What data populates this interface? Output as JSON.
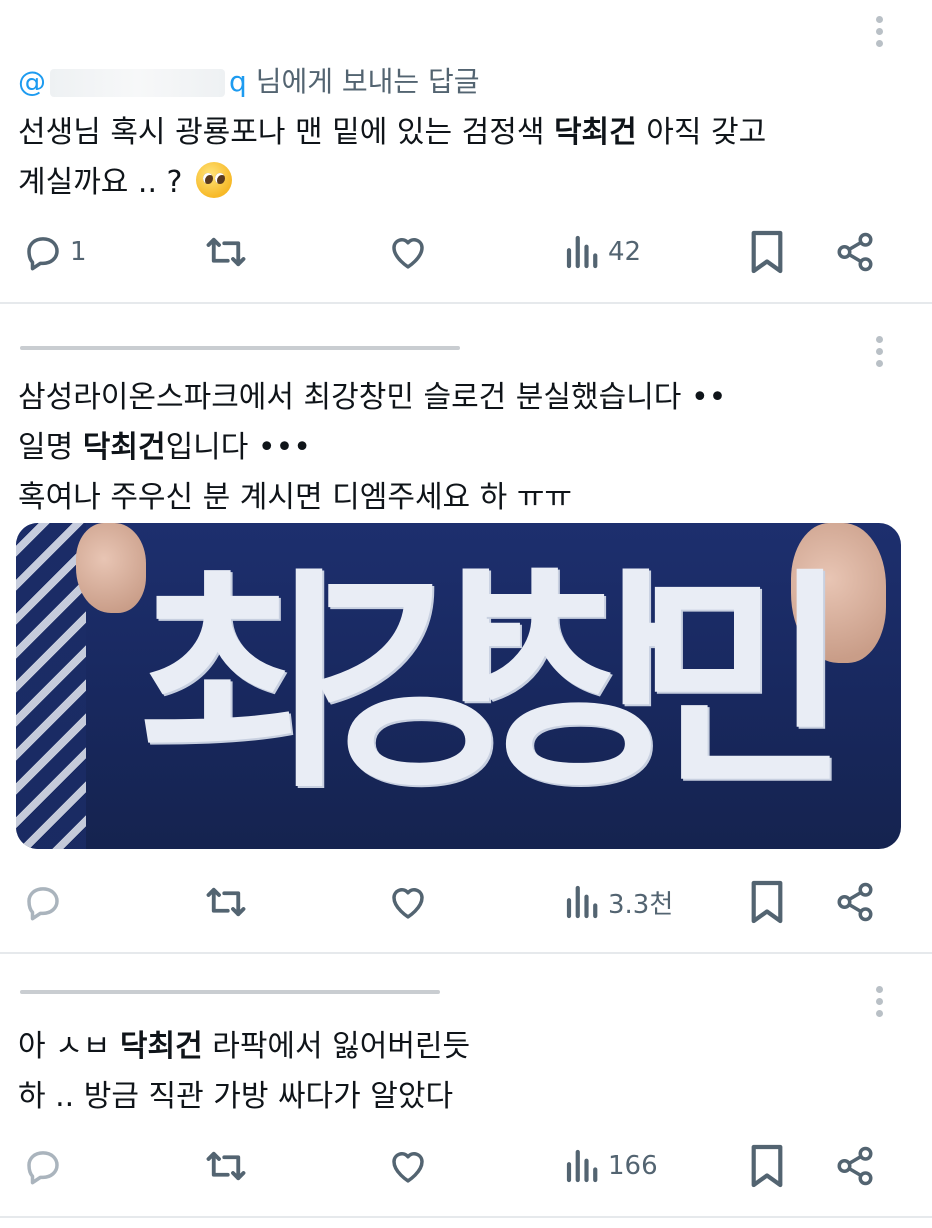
{
  "tweets": [
    {
      "reply_to_prefix": "@",
      "reply_to_suffix": "q",
      "reply_to_label": "님에게 보내는 답글",
      "lines": [
        [
          "선생님 혹시 광룡포나 맨 밑에 있는 검정색 ",
          "닥최건",
          " 아직 갖고"
        ],
        [
          "계실까요 .. ? ",
          "",
          ""
        ]
      ],
      "emoji": "pleading-face",
      "reply_count": "1",
      "view_count": "42"
    },
    {
      "lines": [
        [
          "삼성라이온스파크에서 최강창민 슬로건 분실했습니다 ••",
          "",
          ""
        ],
        [
          "일명 ",
          "닥최건",
          "입니다 •••"
        ],
        [
          "혹여나 주우신 분 계시면 디엠주세요 하 ㅠㅠ",
          "",
          ""
        ]
      ],
      "image_text": [
        "최",
        "강",
        "창",
        "민"
      ],
      "reply_count": "",
      "view_count": "3.3천"
    },
    {
      "lines": [
        [
          "아 ㅅㅂ ",
          "닥최건",
          " 라팍에서 잃어버린듯"
        ],
        [
          "하 .. 방금 직관 가방 싸다가 알았다",
          "",
          ""
        ]
      ],
      "reply_count": "",
      "view_count": "166"
    }
  ],
  "icons": {
    "reply": "reply-icon",
    "retweet": "retweet-icon",
    "like": "heart-icon",
    "views": "views-icon",
    "bookmark": "bookmark-icon",
    "share": "share-icon",
    "more": "more-icon"
  },
  "colors": {
    "text": "#0f1419",
    "secondary": "#536471",
    "link": "#1d9bf0",
    "divider": "#e6e9ec"
  }
}
